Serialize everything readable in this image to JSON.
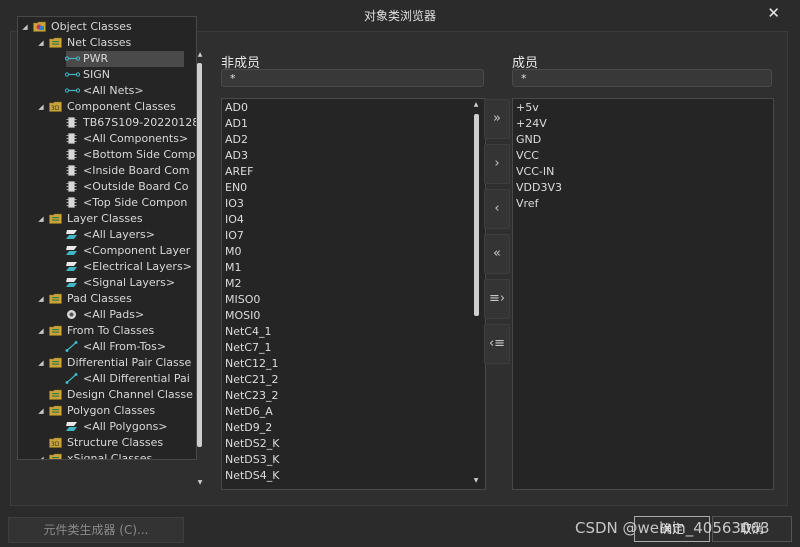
{
  "dialog": {
    "title": "对象类浏览器"
  },
  "tree": [
    {
      "label": "Object Classes",
      "icon": "folder-classes-icon",
      "level": 0,
      "expanded": true
    },
    {
      "label": "Net Classes",
      "icon": "net-class-folder-icon",
      "level": 1,
      "expanded": true
    },
    {
      "label": "PWR",
      "icon": "net-icon",
      "level": 2,
      "selected": true
    },
    {
      "label": "SIGN",
      "icon": "net-icon",
      "level": 2
    },
    {
      "label": "<All Nets>",
      "icon": "net-icon",
      "level": 2
    },
    {
      "label": "Component Classes",
      "icon": "component-class-folder-icon",
      "level": 1,
      "expanded": true
    },
    {
      "label": "TB67S109-20220128",
      "icon": "component-icon",
      "level": 2
    },
    {
      "label": "<All Components>",
      "icon": "component-icon",
      "level": 2
    },
    {
      "label": "<Bottom Side Comp",
      "icon": "component-icon",
      "level": 2
    },
    {
      "label": "<Inside Board Com",
      "icon": "component-icon",
      "level": 2
    },
    {
      "label": "<Outside Board Co",
      "icon": "component-icon",
      "level": 2
    },
    {
      "label": "<Top Side Compon",
      "icon": "component-icon",
      "level": 2
    },
    {
      "label": "Layer Classes",
      "icon": "layer-class-folder-icon",
      "level": 1,
      "expanded": true
    },
    {
      "label": "<All Layers>",
      "icon": "layer-icon",
      "level": 2
    },
    {
      "label": "<Component Layer",
      "icon": "layer-icon",
      "level": 2
    },
    {
      "label": "<Electrical Layers>",
      "icon": "layer-icon",
      "level": 2
    },
    {
      "label": "<Signal Layers>",
      "icon": "layer-icon",
      "level": 2
    },
    {
      "label": "Pad Classes",
      "icon": "pad-class-folder-icon",
      "level": 1,
      "expanded": true
    },
    {
      "label": "<All Pads>",
      "icon": "pad-icon",
      "level": 2
    },
    {
      "label": "From To Classes",
      "icon": "fromto-class-folder-icon",
      "level": 1,
      "expanded": true
    },
    {
      "label": "<All From-Tos>",
      "icon": "fromto-icon",
      "level": 2
    },
    {
      "label": "Differential Pair Classe",
      "icon": "diffpair-class-folder-icon",
      "level": 1,
      "expanded": true
    },
    {
      "label": "<All Differential Pai",
      "icon": "fromto-icon",
      "level": 2
    },
    {
      "label": "Design Channel Classe",
      "icon": "channel-class-folder-icon",
      "level": 1
    },
    {
      "label": "Polygon Classes",
      "icon": "polygon-class-folder-icon",
      "level": 1,
      "expanded": true
    },
    {
      "label": "<All Polygons>",
      "icon": "layer-icon",
      "level": 2
    },
    {
      "label": "Structure Classes",
      "icon": "structure-class-folder-icon",
      "level": 1
    },
    {
      "label": "xSignal Classes",
      "icon": "xsignal-class-folder-icon",
      "level": 1,
      "expanded": true
    }
  ],
  "non_members": {
    "header": "非成员",
    "filter": "*",
    "items": [
      "AD0",
      "AD1",
      "AD2",
      "AD3",
      "AREF",
      "EN0",
      "IO3",
      "IO4",
      "IO7",
      "M0",
      "M1",
      "M2",
      "MISO0",
      "MOSI0",
      "NetC4_1",
      "NetC7_1",
      "NetC12_1",
      "NetC21_2",
      "NetC23_2",
      "NetD6_A",
      "NetD9_2",
      "NetDS2_K",
      "NetDS3_K",
      "NetDS4_K"
    ]
  },
  "members": {
    "header": "成员",
    "filter": "*",
    "items": [
      "+5v",
      "+24V",
      "GND",
      "VCC",
      "VCC-IN",
      "VDD3V3",
      "Vref"
    ]
  },
  "move_buttons": [
    {
      "icon": "add-all-icon",
      "glyph": "»",
      "action": "add-all"
    },
    {
      "icon": "add-selected-icon",
      "glyph": "›",
      "action": "add"
    },
    {
      "icon": "remove-selected-icon",
      "glyph": "‹",
      "action": "remove"
    },
    {
      "icon": "remove-all-icon",
      "glyph": "«",
      "action": "remove-all"
    },
    {
      "icon": "add-list-icon",
      "glyph": "≡›",
      "action": "add-list"
    },
    {
      "icon": "remove-list-icon",
      "glyph": "‹≡",
      "action": "remove-list"
    }
  ],
  "footer": {
    "generator_label": "元件类生成器 (C)...",
    "ok_label": "确定",
    "cancel_label": "取消",
    "watermark": "CSDN @weixin_40563063"
  },
  "colors": {
    "accent": "#3fb7c4",
    "folder": "#c9a43a",
    "selection": "#4a4a4a"
  }
}
